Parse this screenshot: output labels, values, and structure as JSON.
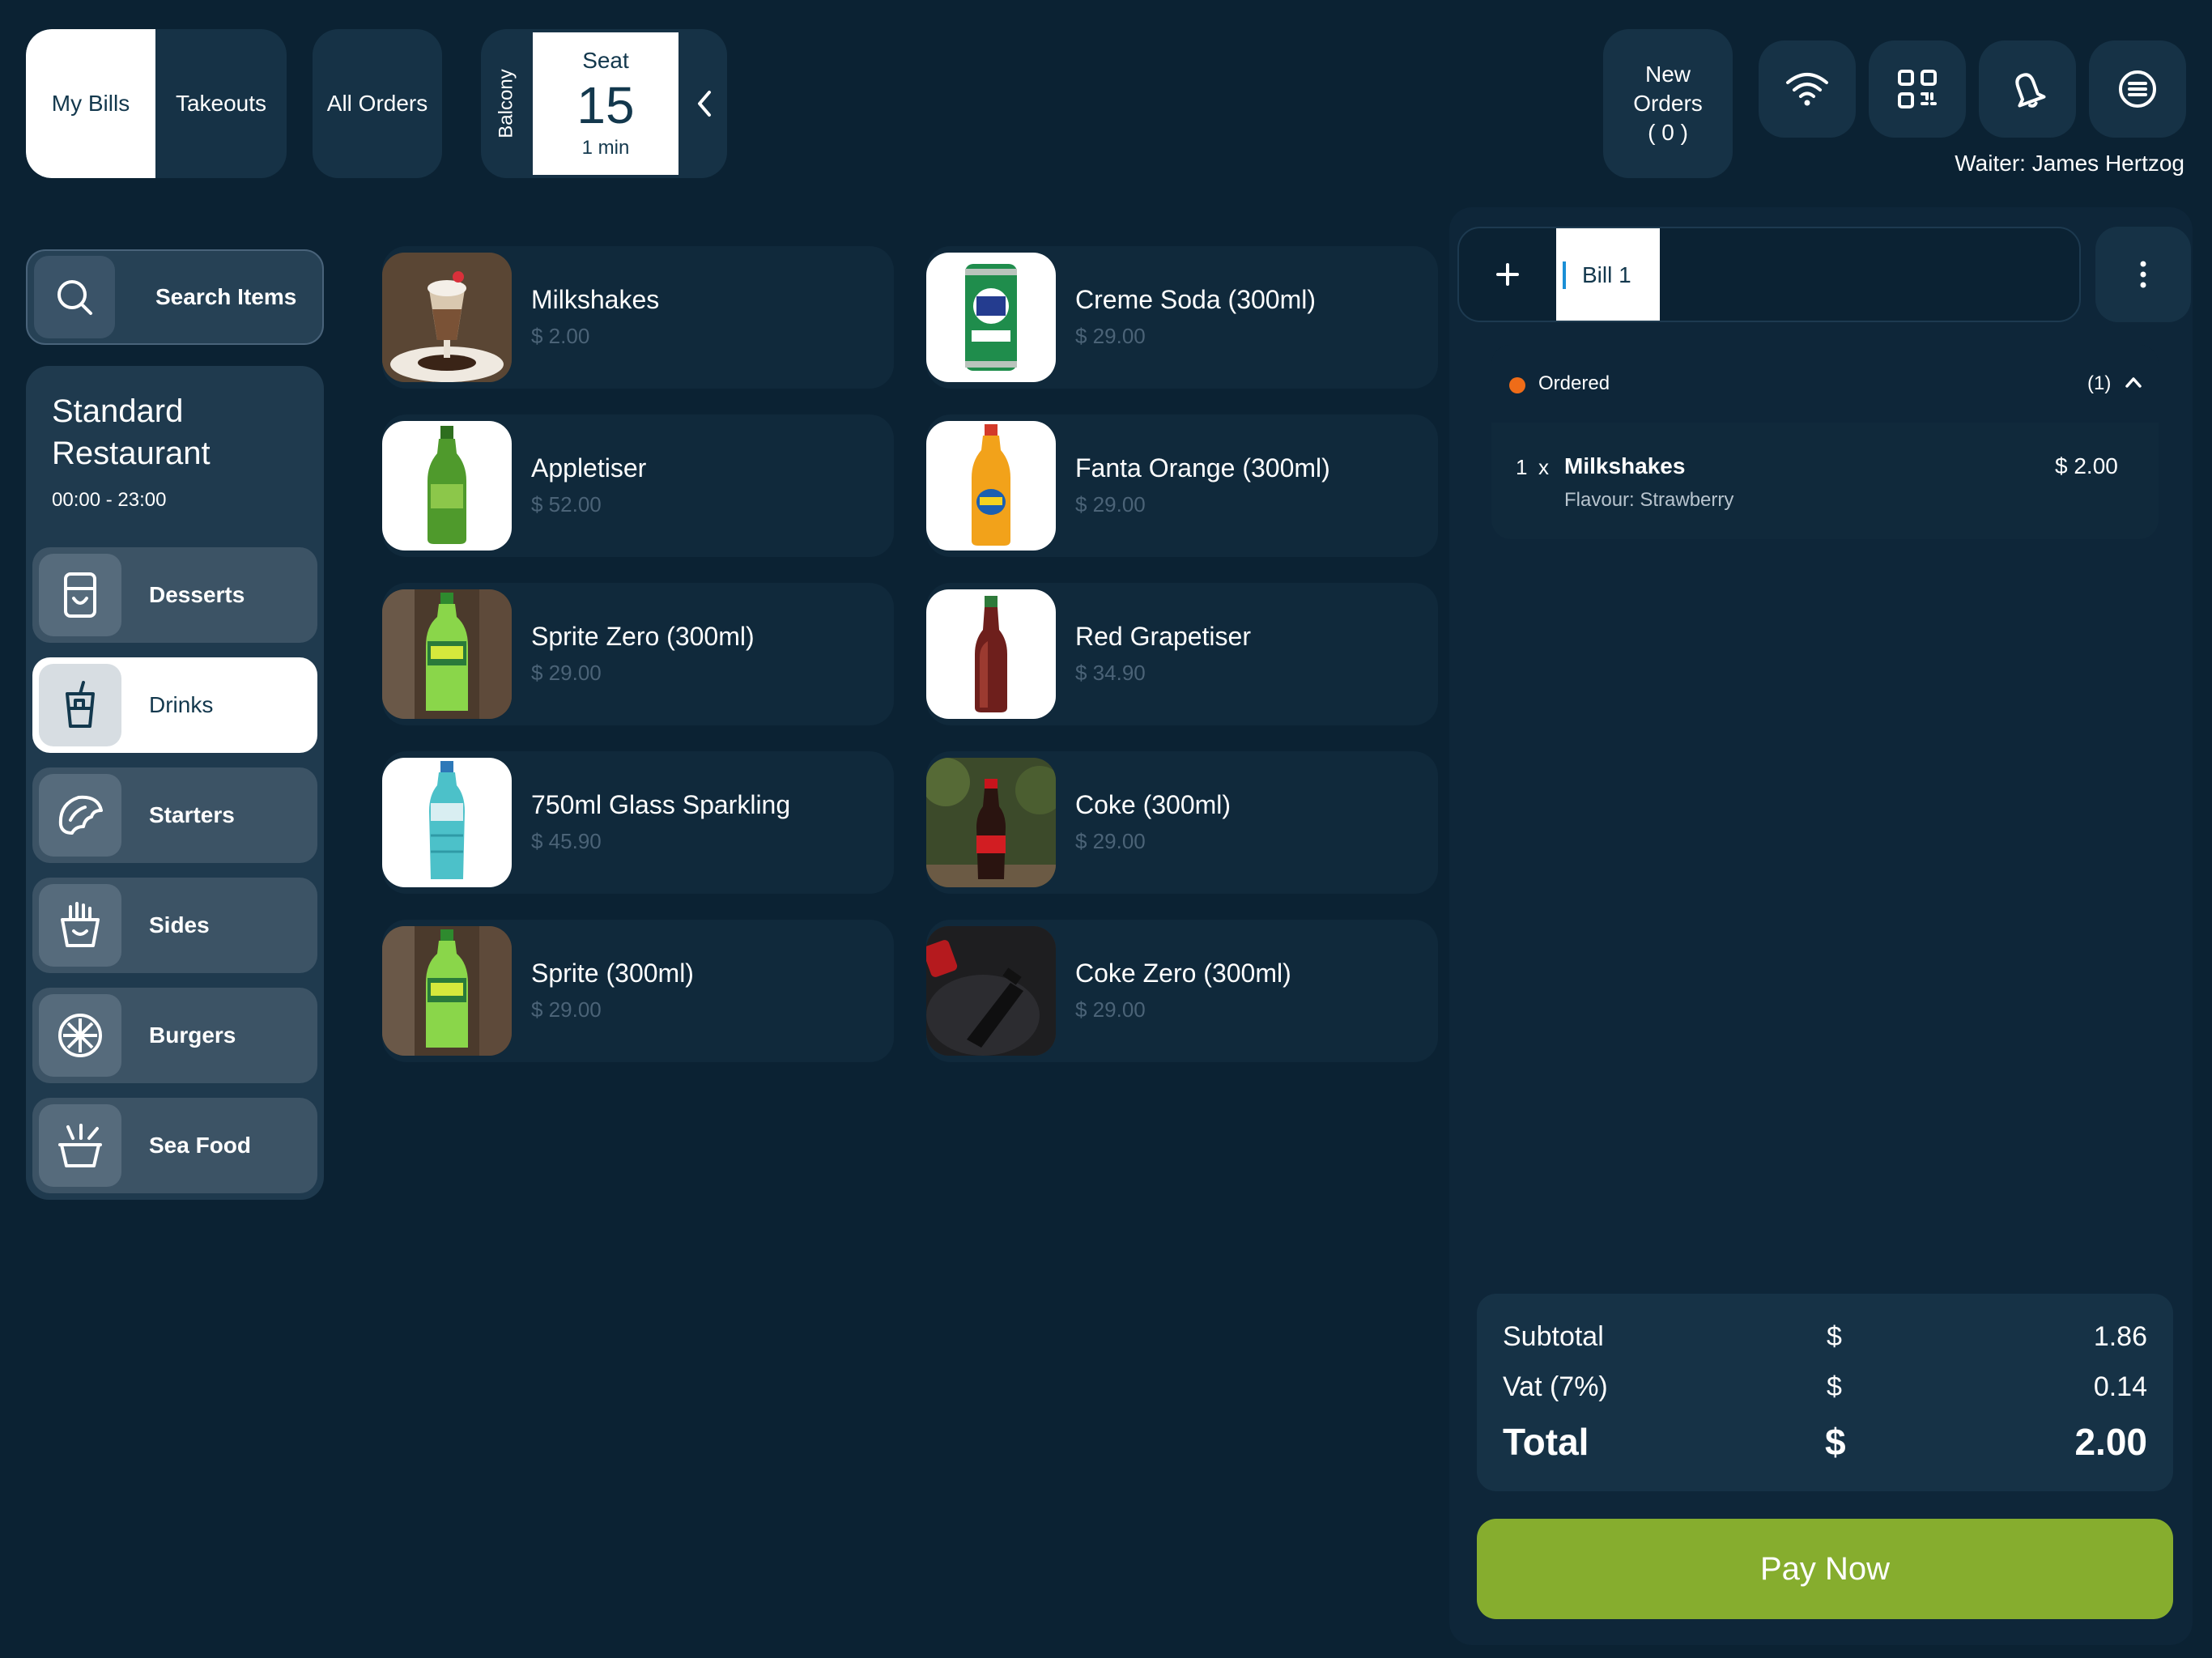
{
  "header": {
    "tabs": [
      {
        "label": "My Bills",
        "active": true
      },
      {
        "label": "Takeouts",
        "active": false
      }
    ],
    "all_orders_label": "All Orders",
    "seat": {
      "area": "Balcony",
      "label": "Seat",
      "number": "15",
      "elapsed": "1 min"
    },
    "new_orders": {
      "line1": "New",
      "line2": "Orders",
      "count": "( 0 )"
    },
    "icons": [
      "wifi-icon",
      "qr-code-icon",
      "bell-icon",
      "menu-icon"
    ],
    "waiter": "Waiter: James Hertzog"
  },
  "sidebar": {
    "search_label": "Search Items",
    "restaurant_name": "Standard Restaurant",
    "hours": "00:00 - 23:00",
    "categories": [
      {
        "label": "Desserts",
        "icon": "dessert-icon",
        "active": false
      },
      {
        "label": "Drinks",
        "icon": "drink-icon",
        "active": true
      },
      {
        "label": "Starters",
        "icon": "starter-icon",
        "active": false
      },
      {
        "label": "Sides",
        "icon": "fries-icon",
        "active": false
      },
      {
        "label": "Burgers",
        "icon": "burger-icon",
        "active": false
      },
      {
        "label": "Sea Food",
        "icon": "seafood-icon",
        "active": false
      }
    ]
  },
  "products": [
    {
      "name": "Milkshakes",
      "price": "$ 2.00",
      "image": "milkshake"
    },
    {
      "name": "Creme Soda (300ml)",
      "price": "$ 29.00",
      "image": "green-can"
    },
    {
      "name": "Appletiser",
      "price": "$ 52.00",
      "image": "green-bottle"
    },
    {
      "name": "Fanta Orange (300ml)",
      "price": "$ 29.00",
      "image": "orange-bottle"
    },
    {
      "name": "Sprite Zero (300ml)",
      "price": "$ 29.00",
      "image": "sprite-bottle"
    },
    {
      "name": "Red Grapetiser",
      "price": "$ 34.90",
      "image": "red-bottle"
    },
    {
      "name": "750ml Glass Sparkling",
      "price": "$ 45.90",
      "image": "blue-bottle"
    },
    {
      "name": "Coke (300ml)",
      "price": "$ 29.00",
      "image": "coke-bottle"
    },
    {
      "name": "Sprite (300ml)",
      "price": "$ 29.00",
      "image": "sprite-bottle"
    },
    {
      "name": "Coke Zero (300ml)",
      "price": "$ 29.00",
      "image": "coke-zero-bottle"
    }
  ],
  "bill": {
    "tab_label": "Bill 1",
    "status_label": "Ordered",
    "status_count": "(1)",
    "status_color": "#ef6c18",
    "lines": [
      {
        "qty": "1",
        "x": "x",
        "name": "Milkshakes",
        "price": "$ 2.00",
        "modifier": "Flavour: Strawberry"
      }
    ],
    "totals": {
      "subtotal_label": "Subtotal",
      "subtotal_currency": "$",
      "subtotal": "1.86",
      "vat_label": "Vat (7%)",
      "vat_currency": "$",
      "vat": "0.14",
      "total_label": "Total",
      "total_currency": "$",
      "total": "2.00"
    },
    "pay_label": "Pay Now",
    "pay_color": "#86ad2e"
  }
}
